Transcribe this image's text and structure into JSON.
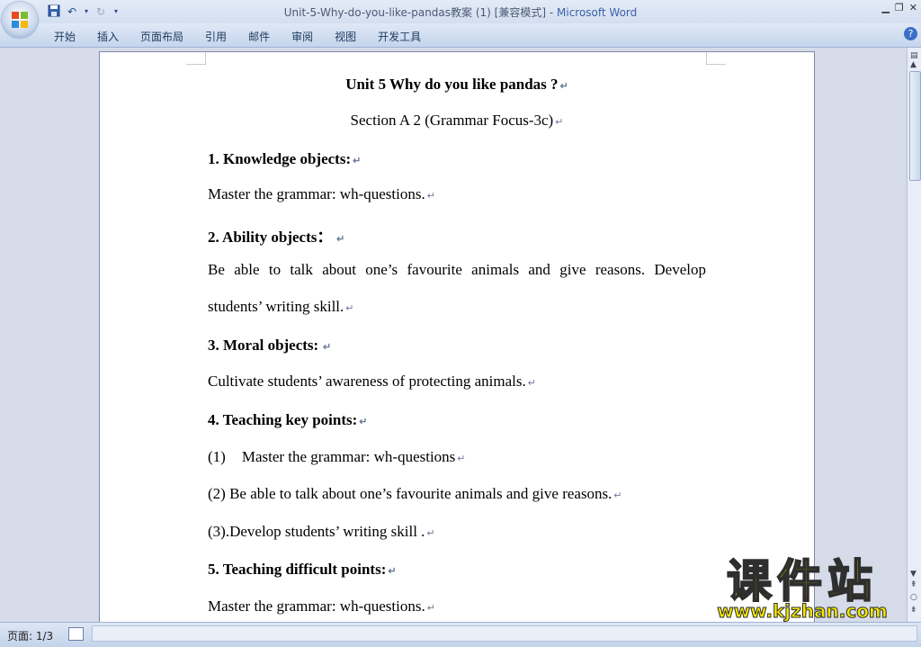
{
  "window": {
    "title_doc": "Unit-5-Why-do-you-like-pandas教案 (1) [兼容模式]",
    "title_separator": " - ",
    "title_app": "Microsoft Word"
  },
  "ribbon": {
    "tabs": [
      "开始",
      "插入",
      "页面布局",
      "引用",
      "邮件",
      "审阅",
      "视图",
      "开发工具"
    ]
  },
  "document": {
    "title": "Unit 5 Why do you like pandas ?",
    "subtitle": "Section A 2 (Grammar Focus-3c)",
    "h1": "1.  Knowledge objects:",
    "p1": "Master the grammar: wh-questions.",
    "h2": "2.  Ability objects：",
    "p2a": "Be able to talk about one’s favourite animals and give reasons. Develop",
    "p2b": "students’ writing skill.",
    "h3": "3.  Moral objects:",
    "p3": "Cultivate students’ awareness of protecting animals.",
    "h4": "4. Teaching key points:",
    "li1_num": "(1)",
    "li1_text": "Master the grammar: wh-questions",
    "li2": "(2) Be able to talk about one’s favourite animals and give reasons.",
    "li3": "(3).Develop students’ writing skill .",
    "h5": "5. Teaching difficult points:",
    "p5": "Master the grammar: wh-questions."
  },
  "status": {
    "page": "页面: 1/3"
  },
  "watermark": {
    "cn": "课件站",
    "en": "www.kjzhan.com"
  },
  "colors": {
    "accent": "#3b5fa8",
    "watermark": "#f2e800"
  }
}
